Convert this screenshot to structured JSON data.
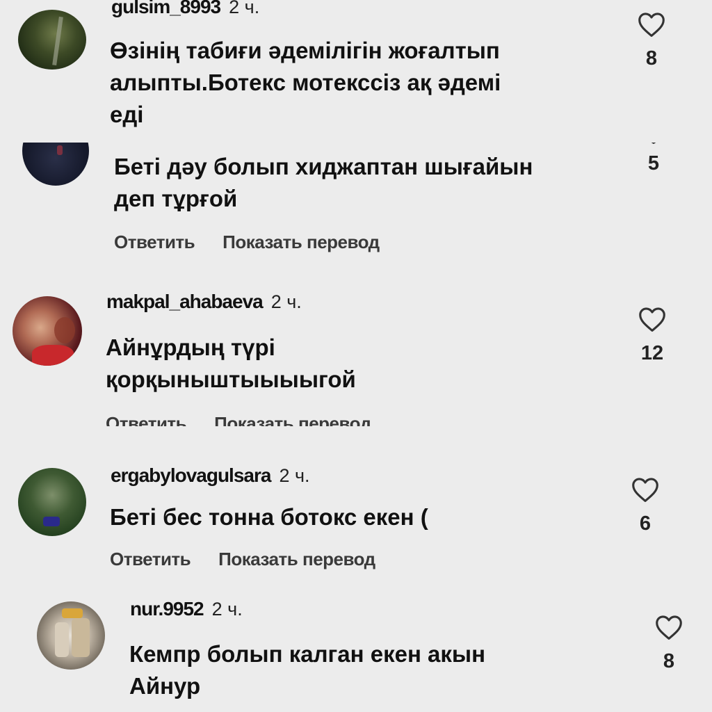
{
  "comments": [
    {
      "username": "gulsim_8993",
      "time": "2 ч.",
      "text": "Өзінің табиғи әдемілігін жоғалтып\nалыпты.Ботекс мотекссіз ақ әдемі\nеді",
      "likes": "8"
    },
    {
      "username": "",
      "time": "",
      "text": "Беті дәу болып хиджаптан шығайын\nдеп тұрғой",
      "likes": "5",
      "reply_label": "Ответить",
      "translate_label": "Показать перевод"
    },
    {
      "username": "makpal_ahabaeva",
      "time": "2 ч.",
      "text": "Айнұрдың түрі\nқорқыныштыыыыгой",
      "likes": "12",
      "reply_label": "Ответить",
      "translate_label": "Показать перевод"
    },
    {
      "username": "ergabylovagulsara",
      "time": "2 ч.",
      "text": "Беті бес тонна ботокс екен (",
      "likes": "6",
      "reply_label": "Ответить",
      "translate_label": "Показать перевод"
    },
    {
      "username": "nur.9952",
      "time": "2 ч.",
      "text": "Кемпр болып калган екен акын\nАйнур",
      "likes": "8"
    }
  ],
  "colors": {
    "background": "#ececec",
    "text": "#111111",
    "secondary": "#3a3a3a"
  },
  "icons": {
    "like": "heart-outline-icon"
  }
}
